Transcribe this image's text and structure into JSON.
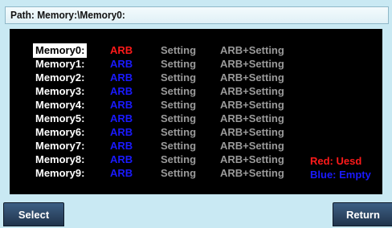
{
  "path": {
    "text": "Path: Memory:\\Memory0:"
  },
  "colors": {
    "used": "#ff1a1a",
    "empty": "#1a1aff",
    "inactive": "#9a9a9a"
  },
  "memory_list": [
    {
      "name": "Memory0:",
      "arb": "ARB",
      "arb_state": "used",
      "setting": "Setting",
      "arb_setting": "ARB+Setting",
      "selected": true
    },
    {
      "name": "Memory1:",
      "arb": "ARB",
      "arb_state": "empty",
      "setting": "Setting",
      "arb_setting": "ARB+Setting",
      "selected": false
    },
    {
      "name": "Memory2:",
      "arb": "ARB",
      "arb_state": "empty",
      "setting": "Setting",
      "arb_setting": "ARB+Setting",
      "selected": false
    },
    {
      "name": "Memory3:",
      "arb": "ARB",
      "arb_state": "empty",
      "setting": "Setting",
      "arb_setting": "ARB+Setting",
      "selected": false
    },
    {
      "name": "Memory4:",
      "arb": "ARB",
      "arb_state": "empty",
      "setting": "Setting",
      "arb_setting": "ARB+Setting",
      "selected": false
    },
    {
      "name": "Memory5:",
      "arb": "ARB",
      "arb_state": "empty",
      "setting": "Setting",
      "arb_setting": "ARB+Setting",
      "selected": false
    },
    {
      "name": "Memory6:",
      "arb": "ARB",
      "arb_state": "empty",
      "setting": "Setting",
      "arb_setting": "ARB+Setting",
      "selected": false
    },
    {
      "name": "Memory7:",
      "arb": "ARB",
      "arb_state": "empty",
      "setting": "Setting",
      "arb_setting": "ARB+Setting",
      "selected": false
    },
    {
      "name": "Memory8:",
      "arb": "ARB",
      "arb_state": "empty",
      "setting": "Setting",
      "arb_setting": "ARB+Setting",
      "selected": false
    },
    {
      "name": "Memory9:",
      "arb": "ARB",
      "arb_state": "empty",
      "setting": "Setting",
      "arb_setting": "ARB+Setting",
      "selected": false
    }
  ],
  "legend": {
    "used": "Red: Uesd",
    "empty": "Blue: Empty"
  },
  "softkeys": {
    "select": "Select",
    "return": "Return"
  }
}
